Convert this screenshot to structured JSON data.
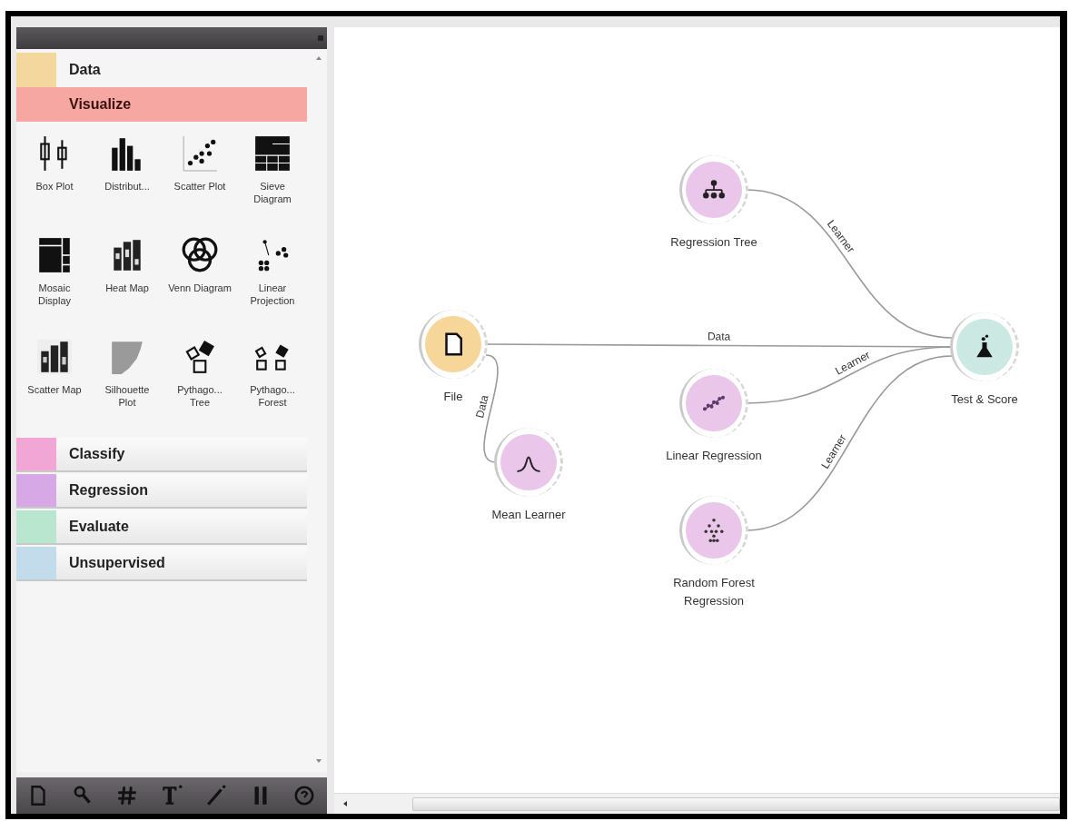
{
  "sidebar": {
    "categories": [
      {
        "label": "Data",
        "color": "#f3d79c",
        "selected": false
      },
      {
        "label": "Visualize",
        "color": "#f7a7a2",
        "selected": true,
        "widgets": [
          {
            "label": "Box Plot"
          },
          {
            "label": "Distribut..."
          },
          {
            "label": "Scatter Plot"
          },
          {
            "label": "Sieve Diagram"
          },
          {
            "label": "Mosaic Display"
          },
          {
            "label": "Heat Map"
          },
          {
            "label": "Venn Diagram"
          },
          {
            "label": "Linear Projection"
          },
          {
            "label": "Scatter Map"
          },
          {
            "label": "Silhouette Plot"
          },
          {
            "label": "Pythago... Tree"
          },
          {
            "label": "Pythago... Forest"
          }
        ]
      },
      {
        "label": "Classify",
        "color": "#f2a6d6",
        "selected": false
      },
      {
        "label": "Regression",
        "color": "#d6a9e6",
        "selected": false
      },
      {
        "label": "Evaluate",
        "color": "#b9e6cf",
        "selected": false
      },
      {
        "label": "Unsupervised",
        "color": "#c3dcec",
        "selected": false
      }
    ]
  },
  "canvas": {
    "nodes": [
      {
        "label": "File",
        "color": "#f7d69a"
      },
      {
        "label": "Mean Learner",
        "color": "#e9c6ea"
      },
      {
        "label": "Regression Tree",
        "color": "#e9c6ea"
      },
      {
        "label": "Linear Regression",
        "color": "#e9c6ea"
      },
      {
        "label": "Random Forest Regression",
        "color": "#e9c6ea"
      },
      {
        "label": "Test & Score",
        "color": "#cbe9e2"
      }
    ],
    "links": [
      {
        "label": "Data"
      },
      {
        "label": "Data"
      },
      {
        "label": "Learner"
      },
      {
        "label": "Learner"
      },
      {
        "label": "Learner"
      }
    ]
  }
}
